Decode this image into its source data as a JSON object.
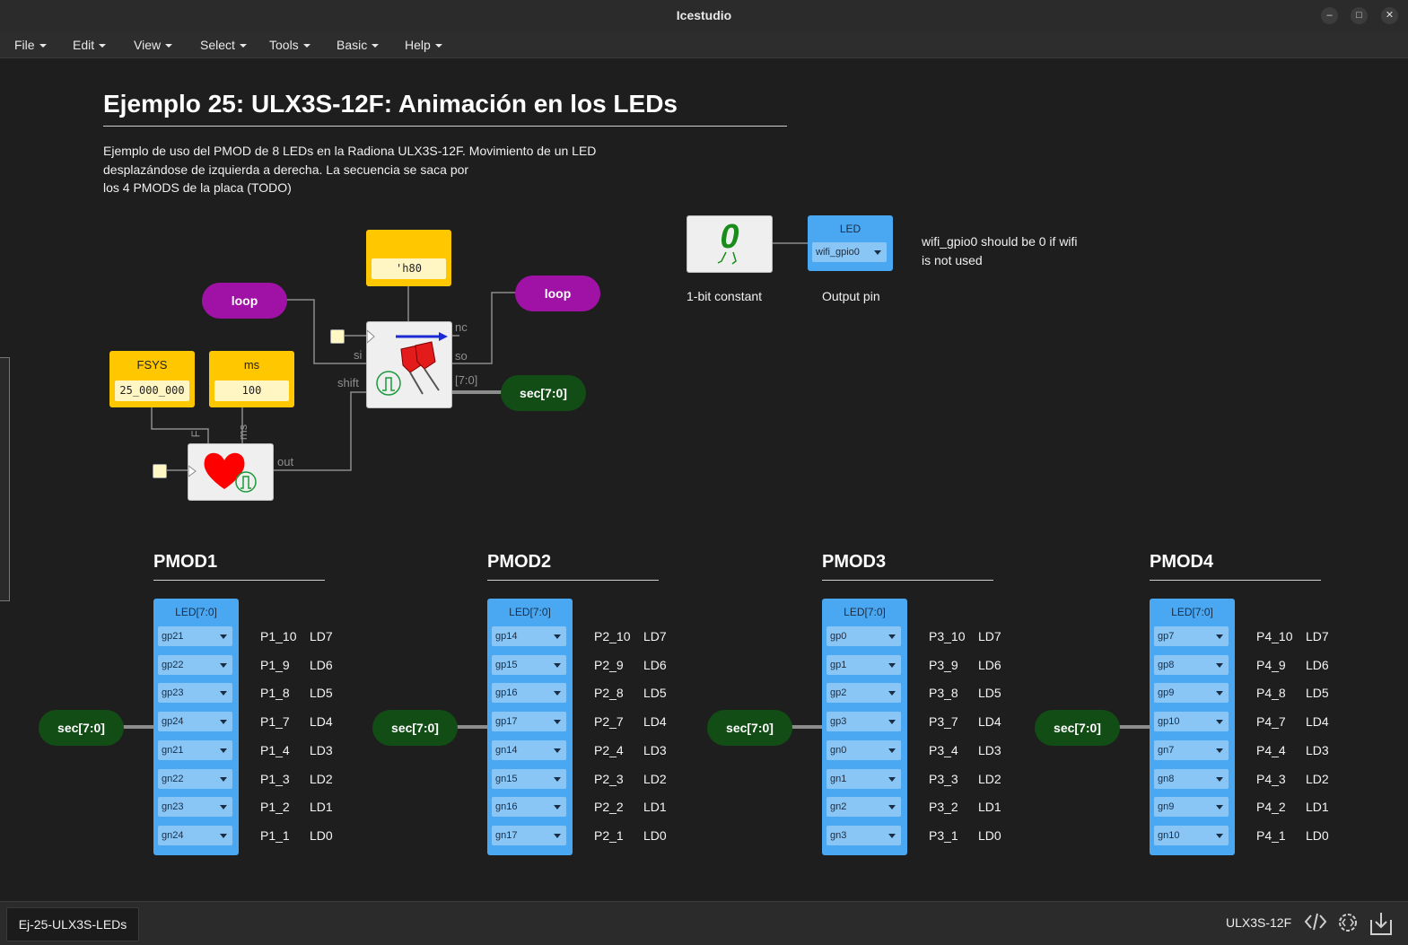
{
  "window": {
    "title": "Icestudio",
    "controls": [
      "–",
      "□",
      "✕"
    ]
  },
  "menu": {
    "items": [
      "File",
      "Edit",
      "View",
      "Select",
      "Tools",
      "Basic",
      "Help"
    ]
  },
  "project": {
    "title": "Ejemplo 25: ULX3S-12F: Animación en los LEDs",
    "desc_lines": [
      "Ejemplo de uso del PMOD de 8 LEDs en la Radiona ULX3S-12F. Movimiento de un LED",
      "desplazándose de izquierda a derecha. La secuencia se saca por",
      "los 4 PMODS de la placa (TODO)"
    ]
  },
  "circuit": {
    "loop_left": "loop",
    "loop_right": "loop",
    "const_h80": "'h80",
    "fsys_label": "FSYS",
    "fsys_value": "25_000_000",
    "ms_label": "ms",
    "ms_value": "100",
    "sec_out": "sec[7:0]",
    "ports": {
      "nc": "nc",
      "si": "si",
      "so": "so",
      "shift": "shift",
      "bus": "[7:0]",
      "out": "out",
      "F": "F",
      "ms": "ms"
    }
  },
  "wifi": {
    "const_symbol": "0",
    "const_caption": "1-bit constant",
    "led_label": "LED",
    "led_pin": "wifi_gpio0",
    "out_caption": "Output pin",
    "note_line1": "wifi_gpio0 should be 0 if wifi",
    "note_line2": "is not used"
  },
  "pmods": [
    {
      "title": "PMOD1",
      "header": "LED[7:0]",
      "input": "sec[7:0]",
      "pins": [
        "gp21",
        "gp22",
        "gp23",
        "gp24",
        "gn21",
        "gn22",
        "gn23",
        "gn24"
      ],
      "labels": [
        "P1_10",
        "P1_9",
        "P1_8",
        "P1_7",
        "P1_4",
        "P1_3",
        "P1_2",
        "P1_1"
      ],
      "leds": [
        "LD7",
        "LD6",
        "LD5",
        "LD4",
        "LD3",
        "LD2",
        "LD1",
        "LD0"
      ]
    },
    {
      "title": "PMOD2",
      "header": "LED[7:0]",
      "input": "sec[7:0]",
      "pins": [
        "gp14",
        "gp15",
        "gp16",
        "gp17",
        "gn14",
        "gn15",
        "gn16",
        "gn17"
      ],
      "labels": [
        "P2_10",
        "P2_9",
        "P2_8",
        "P2_7",
        "P2_4",
        "P2_3",
        "P2_2",
        "P2_1"
      ],
      "leds": [
        "LD7",
        "LD6",
        "LD5",
        "LD4",
        "LD3",
        "LD2",
        "LD1",
        "LD0"
      ]
    },
    {
      "title": "PMOD3",
      "header": "LED[7:0]",
      "input": "sec[7:0]",
      "pins": [
        "gp0",
        "gp1",
        "gp2",
        "gp3",
        "gn0",
        "gn1",
        "gn2",
        "gn3"
      ],
      "labels": [
        "P3_10",
        "P3_9",
        "P3_8",
        "P3_7",
        "P3_4",
        "P3_3",
        "P3_2",
        "P3_1"
      ],
      "leds": [
        "LD7",
        "LD6",
        "LD5",
        "LD4",
        "LD3",
        "LD2",
        "LD1",
        "LD0"
      ]
    },
    {
      "title": "PMOD4",
      "header": "LED[7:0]",
      "input": "sec[7:0]",
      "pins": [
        "gp7",
        "gp8",
        "gp9",
        "gp10",
        "gn7",
        "gn8",
        "gn9",
        "gn10"
      ],
      "labels": [
        "P4_10",
        "P4_9",
        "P4_8",
        "P4_7",
        "P4_4",
        "P4_3",
        "P4_2",
        "P4_1"
      ],
      "leds": [
        "LD7",
        "LD6",
        "LD5",
        "LD4",
        "LD3",
        "LD2",
        "LD1",
        "LD0"
      ]
    }
  ],
  "status": {
    "file_tab": "Ej-25-ULX3S-LEDs",
    "board": "ULX3S-12F",
    "icons": [
      "code-icon",
      "settings-code-icon",
      "download-icon"
    ]
  },
  "colors": {
    "constant": "#ffc700",
    "pin_block": "#4aa8f2",
    "loop_label": "#a012a6",
    "bus_label": "#124d16"
  }
}
